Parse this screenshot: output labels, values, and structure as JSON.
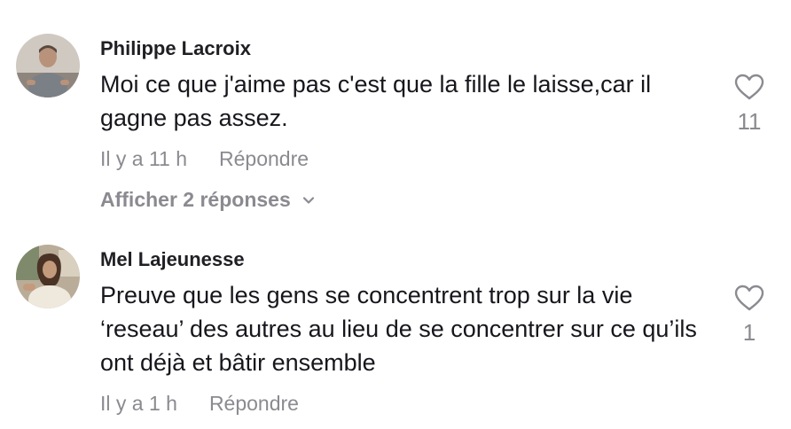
{
  "comments": [
    {
      "author": "Philippe Lacroix",
      "text": "Moi ce que j'aime pas c'est que la fille le laisse,car il gagne pas assez.",
      "time": "Il y a 11 h",
      "reply_label": "Répondre",
      "likes": "11",
      "show_replies": "Afficher 2 réponses"
    },
    {
      "author": "Mel Lajeunesse",
      "text": "Preuve que les gens se concentrent trop sur la vie ‘reseau’ des autres au lieu de se concentrer sur ce qu’ils ont déjà et bâtir ensemble",
      "time": "Il y a 1 h",
      "reply_label": "Répondre",
      "likes": "1"
    }
  ],
  "icons": {
    "like": "heart-outline-icon",
    "expand": "chevron-down-icon"
  },
  "colors": {
    "text": "#16161c",
    "muted": "#8a8a90"
  }
}
